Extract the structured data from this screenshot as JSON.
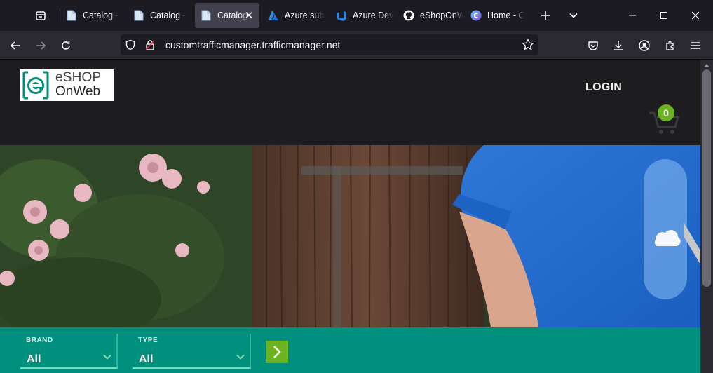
{
  "browser": {
    "tabs": [
      {
        "title": "Catalog - ",
        "icon": "page-icon"
      },
      {
        "title": "Catalog - ",
        "icon": "page-icon"
      },
      {
        "title": "Catalog",
        "icon": "page-icon",
        "active": true
      },
      {
        "title": "Azure sub",
        "icon": "azure-icon"
      },
      {
        "title": "Azure Dev",
        "icon": "azure-devops-icon"
      },
      {
        "title": "eShopOnW",
        "icon": "github-icon"
      },
      {
        "title": "Home - C",
        "icon": "copilot-icon"
      }
    ],
    "url": "customtrafficmanager.trafficmanager.net"
  },
  "site": {
    "logo_line1": "eSHOP",
    "logo_line2": "OnWeb",
    "login_label": "LOGIN",
    "cart_count": "0"
  },
  "filters": {
    "brand": {
      "label": "BRAND",
      "value": "All"
    },
    "type": {
      "label": "TYPE",
      "value": "All"
    }
  },
  "colors": {
    "brand_teal": "#00907d",
    "accent_green": "#6bb41f",
    "header_bg": "#1d1d1f"
  }
}
